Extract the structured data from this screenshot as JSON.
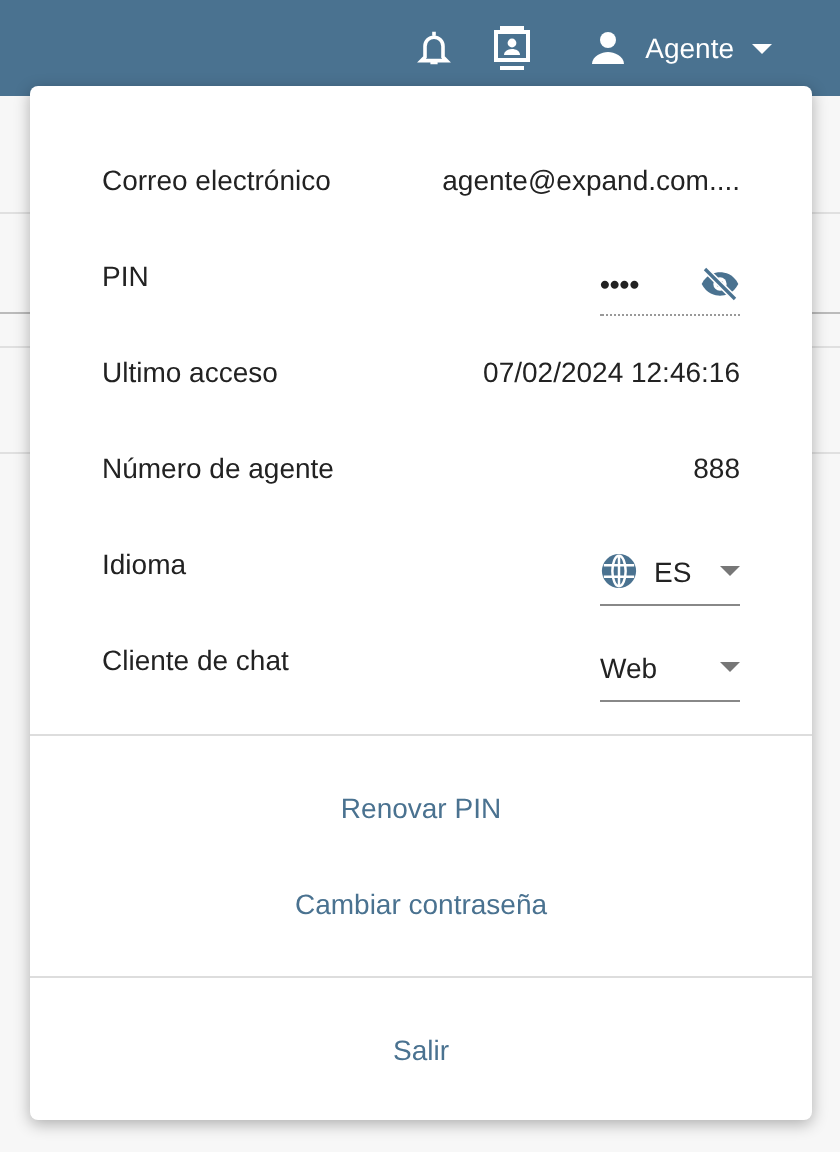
{
  "header": {
    "user_label": "Agente"
  },
  "profile": {
    "rows": [
      {
        "kind": "text",
        "label": "Correo electrónico",
        "value": "agente@expand.com...."
      },
      {
        "kind": "password",
        "label": "PIN",
        "value": "••••",
        "visible": false
      },
      {
        "kind": "text",
        "label": "Ultimo acceso",
        "value": "07/02/2024 12:46:16"
      },
      {
        "kind": "text",
        "label": "Número de agente",
        "value": "888"
      },
      {
        "kind": "select",
        "label": "Idioma",
        "value": "ES",
        "globe": true
      },
      {
        "kind": "select",
        "label": "Cliente de chat",
        "value": "Web",
        "globe": false
      }
    ],
    "actions": [
      "Renovar PIN",
      "Cambiar contraseña"
    ],
    "logout": "Salir"
  }
}
